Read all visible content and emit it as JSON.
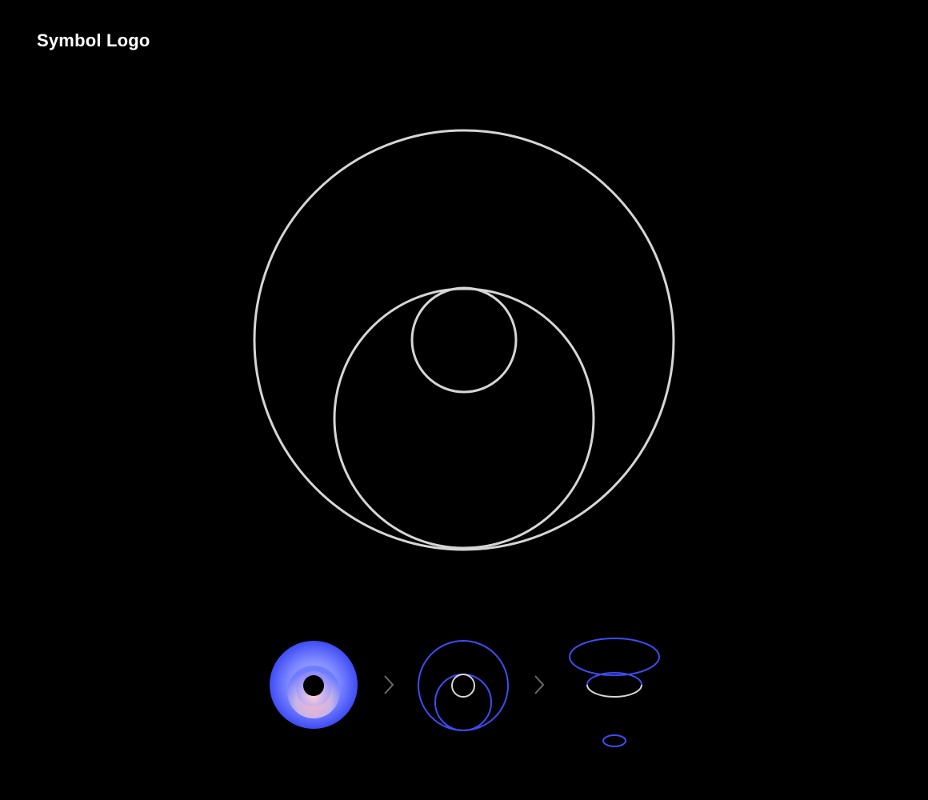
{
  "header": {
    "title": "Symbol Logo"
  },
  "colors": {
    "background": "#000000",
    "outline": "#d6d6d6",
    "accent_blue": "#3f4cf5",
    "gradient_outer": "#4a5cff",
    "gradient_mid": "#9aa3ff",
    "gradient_inner": "#f7b6c9",
    "arrow": "#6b6b6b"
  },
  "icons": {
    "step_arrow": "chevron-right-icon"
  },
  "steps": [
    {
      "name": "gradient-symbol"
    },
    {
      "name": "outline-blue-symbol"
    },
    {
      "name": "perspective-rings-symbol"
    }
  ]
}
